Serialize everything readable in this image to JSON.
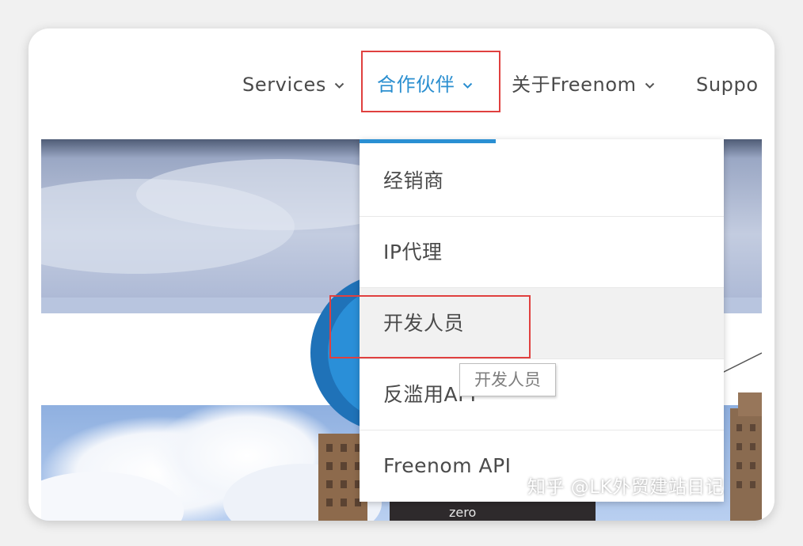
{
  "nav": {
    "items": [
      {
        "label": "Services"
      },
      {
        "label": "合作伙伴"
      },
      {
        "label": "关于Freenom"
      },
      {
        "label": "Suppo"
      }
    ],
    "active_color": "#2b8fd0",
    "highlight_color": "#e0403f"
  },
  "dropdown": {
    "items": [
      {
        "label": "经销商"
      },
      {
        "label": "IP代理"
      },
      {
        "label": "开发人员"
      },
      {
        "label": "反滥用API"
      },
      {
        "label": "Freenom API"
      }
    ],
    "accent_color": "#2a8fd3",
    "hovered_index": 2
  },
  "tooltip": {
    "text": "开发人员"
  },
  "hero": {
    "billboard_text": "zero"
  },
  "watermark": {
    "text": "知乎 @LK外贸建站日记"
  }
}
